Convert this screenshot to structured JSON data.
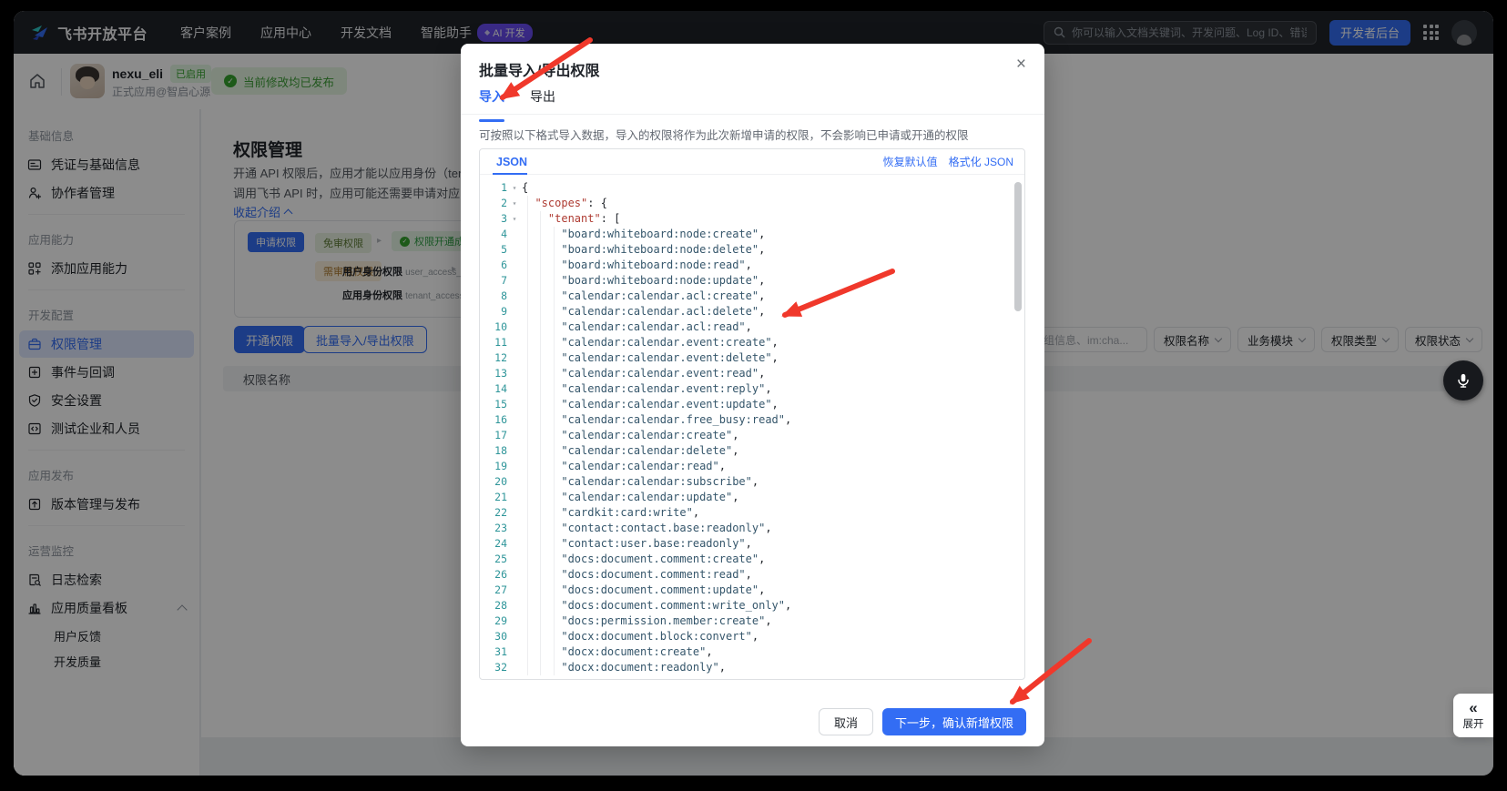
{
  "colors": {
    "accent": "#336df4",
    "arrow_red": "#f0382b",
    "success_green": "#35a42f",
    "line_number_teal": "#2e9599",
    "json_key": "#ae3b32",
    "json_string": "#35566b"
  },
  "navbar": {
    "brand": "飞书开放平台",
    "items": [
      "客户案例",
      "应用中心",
      "开发文档",
      "智能助手"
    ],
    "ai_badge": "AI 开发",
    "search_placeholder": "你可以输入文档关键词、开发问题、Log ID、错误码",
    "console_button": "开发者后台"
  },
  "app_header": {
    "app_name": "nexu_eli",
    "status_badge": "已启用",
    "app_subtitle": "正式应用@智启心源",
    "publish_banner": "当前修改均已发布"
  },
  "sidebar": {
    "sections": [
      {
        "label": "基础信息",
        "items": [
          {
            "id": "credentials",
            "icon": "id-card-icon",
            "label": "凭证与基础信息"
          },
          {
            "id": "collaborators",
            "icon": "user-add-icon",
            "label": "协作者管理"
          }
        ]
      },
      {
        "label": "应用能力",
        "items": [
          {
            "id": "add-capability",
            "icon": "grid-add-icon",
            "label": "添加应用能力"
          }
        ]
      },
      {
        "label": "开发配置",
        "items": [
          {
            "id": "permissions",
            "icon": "briefcase-icon",
            "label": "权限管理",
            "active": true
          },
          {
            "id": "events",
            "icon": "square-plus-icon",
            "label": "事件与回调"
          },
          {
            "id": "security",
            "icon": "shield-icon",
            "label": "安全设置"
          },
          {
            "id": "test-org",
            "icon": "code-icon",
            "label": "测试企业和人员"
          }
        ]
      },
      {
        "label": "应用发布",
        "items": [
          {
            "id": "release",
            "icon": "upload-icon",
            "label": "版本管理与发布"
          }
        ]
      },
      {
        "label": "运营监控",
        "items": [
          {
            "id": "logs",
            "icon": "log-search-icon",
            "label": "日志检索"
          },
          {
            "id": "quality",
            "icon": "chart-icon",
            "label": "应用质量看板",
            "expanded": true,
            "children": [
              "用户反馈",
              "开发质量"
            ]
          }
        ]
      }
    ]
  },
  "main": {
    "title": "权限管理",
    "desc_line1": "开通 API 权限后，应用才能以应用身份（tenant_acc",
    "desc_line2": "调用飞书 API 时，应用可能还需要申请对应的数据权",
    "collapse_link": "收起介绍",
    "flow": {
      "apply_badge": "申请权限",
      "free_badge": "免审权限",
      "free_result": "权限开通成功，可调用 API/事件",
      "review_badge": "需审核权限",
      "user_perm_title": "用户身份权限",
      "user_perm_sub": "user_access_token 调用",
      "tenant_perm_title": "应用身份权限",
      "tenant_perm_sub": "tenant_access_token 调用"
    },
    "open_permission_button": "开通权限",
    "batch_button": "批量导入/导出权限",
    "filters": {
      "search_value": "获取群组信息、im:cha...",
      "dropdowns": [
        "权限名称",
        "业务模块",
        "权限类型",
        "权限状态"
      ]
    },
    "table_header": "权限名称"
  },
  "modal": {
    "title": "批量导入/导出权限",
    "tabs": [
      "导入",
      "导出"
    ],
    "active_tab": "导入",
    "description": "可按照以下格式导入数据，导入的权限将作为此次新增申请的权限，不会影响已申请或开通的权限",
    "editor": {
      "lang_tab": "JSON",
      "reset_link": "恢复默认值",
      "format_link": "格式化 JSON",
      "root_key": "scopes",
      "array_key": "tenant",
      "scopes": [
        "board:whiteboard:node:create",
        "board:whiteboard:node:delete",
        "board:whiteboard:node:read",
        "board:whiteboard:node:update",
        "calendar:calendar.acl:create",
        "calendar:calendar.acl:delete",
        "calendar:calendar.acl:read",
        "calendar:calendar.event:create",
        "calendar:calendar.event:delete",
        "calendar:calendar.event:read",
        "calendar:calendar.event:reply",
        "calendar:calendar.event:update",
        "calendar:calendar.free_busy:read",
        "calendar:calendar:create",
        "calendar:calendar:delete",
        "calendar:calendar:read",
        "calendar:calendar:subscribe",
        "calendar:calendar:update",
        "cardkit:card:write",
        "contact:contact.base:readonly",
        "contact:user.base:readonly",
        "docs:document.comment:create",
        "docs:document.comment:read",
        "docs:document.comment:update",
        "docs:document.comment:write_only",
        "docs:permission.member:create",
        "docx:document.block:convert",
        "docx:document:create",
        "docx:document:readonly"
      ]
    },
    "cancel_button": "取消",
    "confirm_button": "下一步，确认新增权限"
  },
  "floating": {
    "expand_label": "展开",
    "mic_icon": "microphone"
  }
}
